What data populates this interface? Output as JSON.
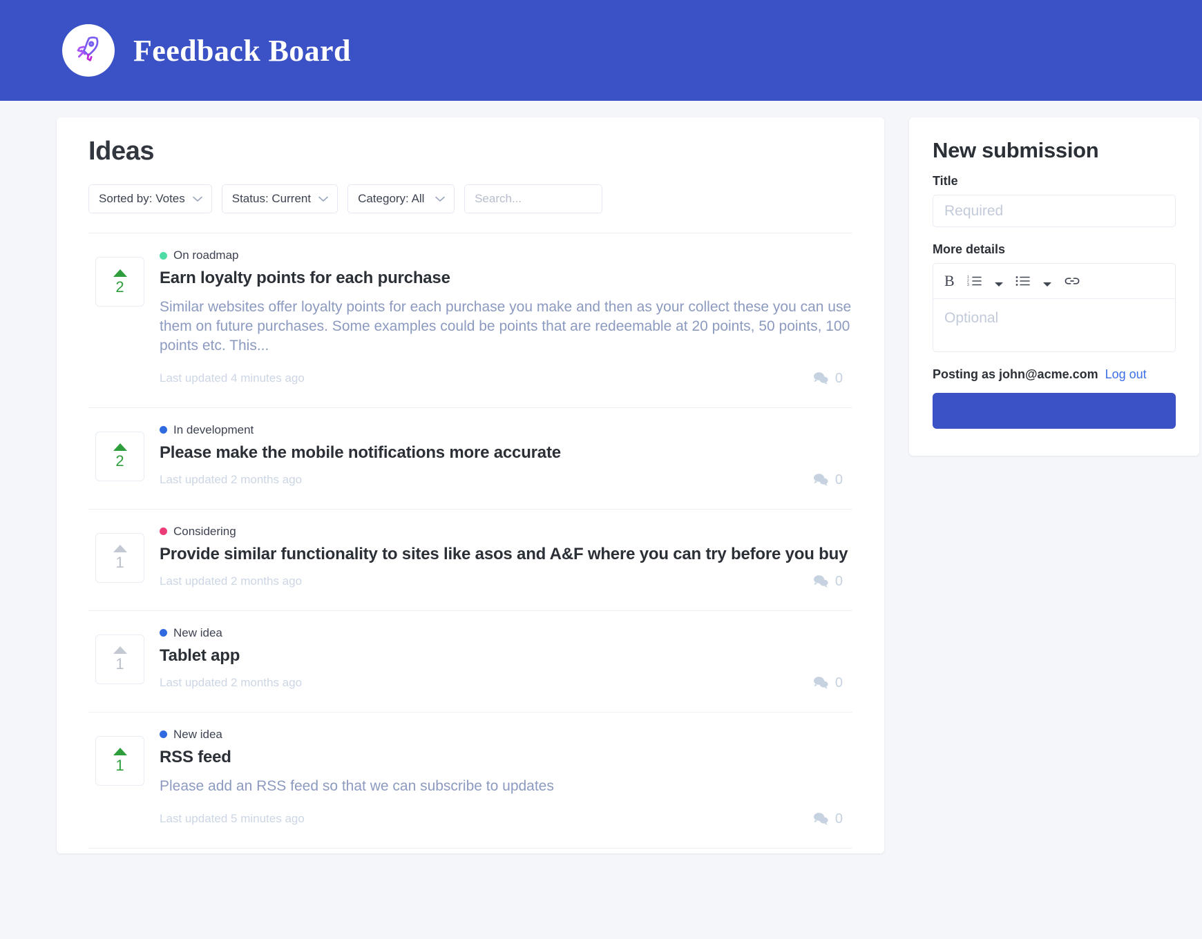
{
  "header": {
    "title": "Feedback Board",
    "logo_icon": "rocket-icon",
    "background_color": "#3b51c6"
  },
  "board": {
    "title": "Ideas",
    "filters": [
      {
        "name": "sort",
        "label": "Sorted by: Votes",
        "icon": "chevron-down-icon"
      },
      {
        "name": "status",
        "label": "Status: Current",
        "icon": "chevron-down-icon"
      },
      {
        "name": "category",
        "label": "Category: All",
        "icon": "chevron-down-icon"
      }
    ],
    "search": {
      "placeholder": "Search..."
    },
    "ideas": [
      {
        "status": "On roadmap",
        "status_color": "#4fdca4",
        "title": "Earn loyalty points for each purchase",
        "description": "Similar websites offer loyalty points for each purchase you make and then as your collect these you can use them on future purchases. Some examples could be points that are redeemable at 20 points, 50 points, 100 points etc. This...",
        "votes": "2",
        "voted": true,
        "updated": "Last updated 4 minutes ago",
        "comments": "0"
      },
      {
        "status": "In development",
        "status_color": "#2f6ae0",
        "title": "Please make the mobile notifications more accurate",
        "description": "",
        "votes": "2",
        "voted": true,
        "updated": "Last updated 2 months ago",
        "comments": "0"
      },
      {
        "status": "Considering",
        "status_color": "#ec3c78",
        "title": "Provide similar functionality to sites like asos and A&F where you can try before you buy",
        "description": "",
        "votes": "1",
        "voted": false,
        "updated": "Last updated 2 months ago",
        "comments": "0"
      },
      {
        "status": "New idea",
        "status_color": "#2f6ae0",
        "title": "Tablet app",
        "description": "",
        "votes": "1",
        "voted": false,
        "updated": "Last updated 2 months ago",
        "comments": "0"
      },
      {
        "status": "New idea",
        "status_color": "#2f6ae0",
        "title": "RSS feed",
        "description": "Please add an RSS feed so that we can subscribe to updates",
        "votes": "1",
        "voted": true,
        "updated": "Last updated 5 minutes ago",
        "comments": "0"
      }
    ]
  },
  "sidebar": {
    "title": "New submission",
    "title_label": "Title",
    "title_placeholder": "Required",
    "details_label": "More details",
    "details_placeholder": "Optional",
    "toolbar": [
      {
        "name": "bold-icon",
        "glyph": "B"
      },
      {
        "name": "ordered-list-icon"
      },
      {
        "name": "chevron-down-icon"
      },
      {
        "name": "bullet-list-icon"
      },
      {
        "name": "chevron-down-icon"
      },
      {
        "name": "link-icon"
      }
    ],
    "posting_as": "Posting as john@acme.com",
    "logout_label": "Log out",
    "submit_label": "",
    "accent_color": "#3b51c6"
  }
}
